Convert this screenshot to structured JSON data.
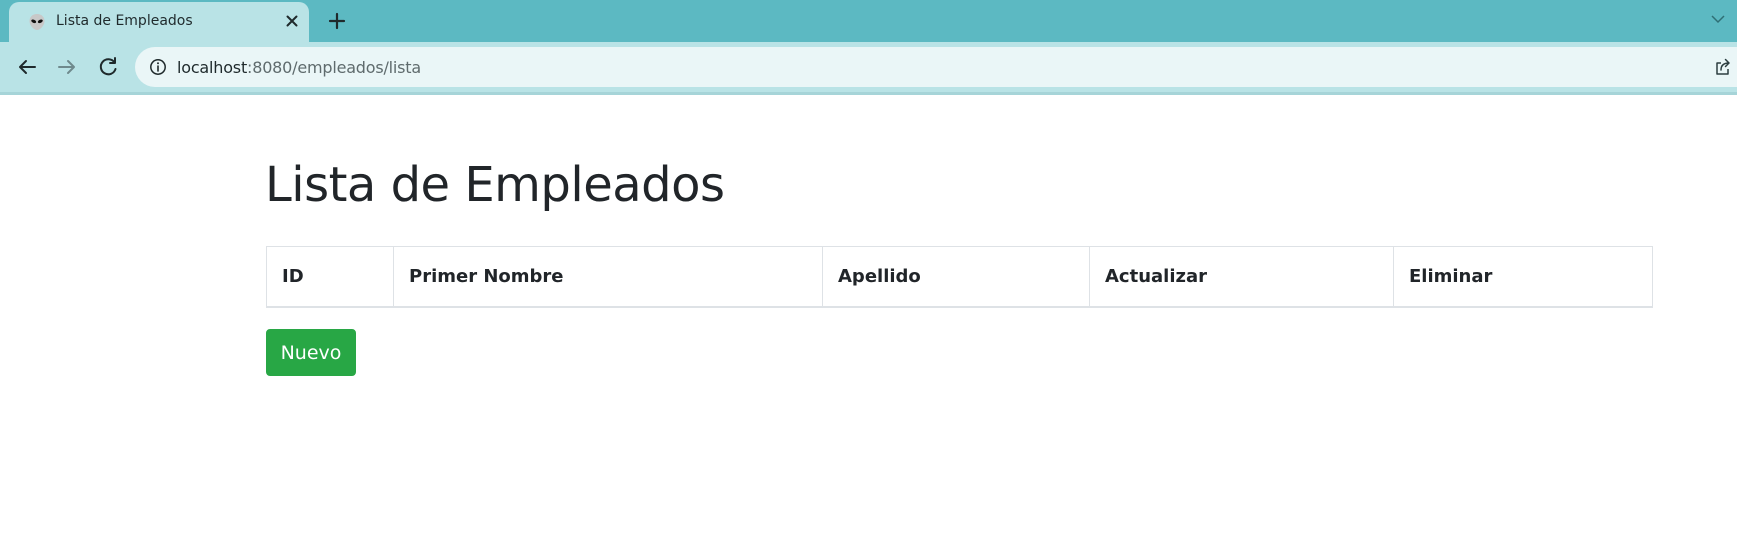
{
  "browser": {
    "tab": {
      "title": "Lista de Empleados",
      "favicon": "alien-icon"
    },
    "address": {
      "host": "localhost",
      "path": ":8080/empleados/lista"
    },
    "colors": {
      "tabstrip": "#5cb9c2",
      "toolbar": "#b9e3e6",
      "omnibox": "#eaf6f7"
    }
  },
  "page": {
    "title": "Lista de Empleados",
    "table": {
      "columns": [
        "ID",
        "Primer Nombre",
        "Apellido",
        "Actualizar",
        "Eliminar"
      ],
      "rows": []
    },
    "new_button_label": "Nuevo",
    "colors": {
      "success": "#28a745",
      "text": "#212529",
      "border": "#dee2e6"
    }
  }
}
